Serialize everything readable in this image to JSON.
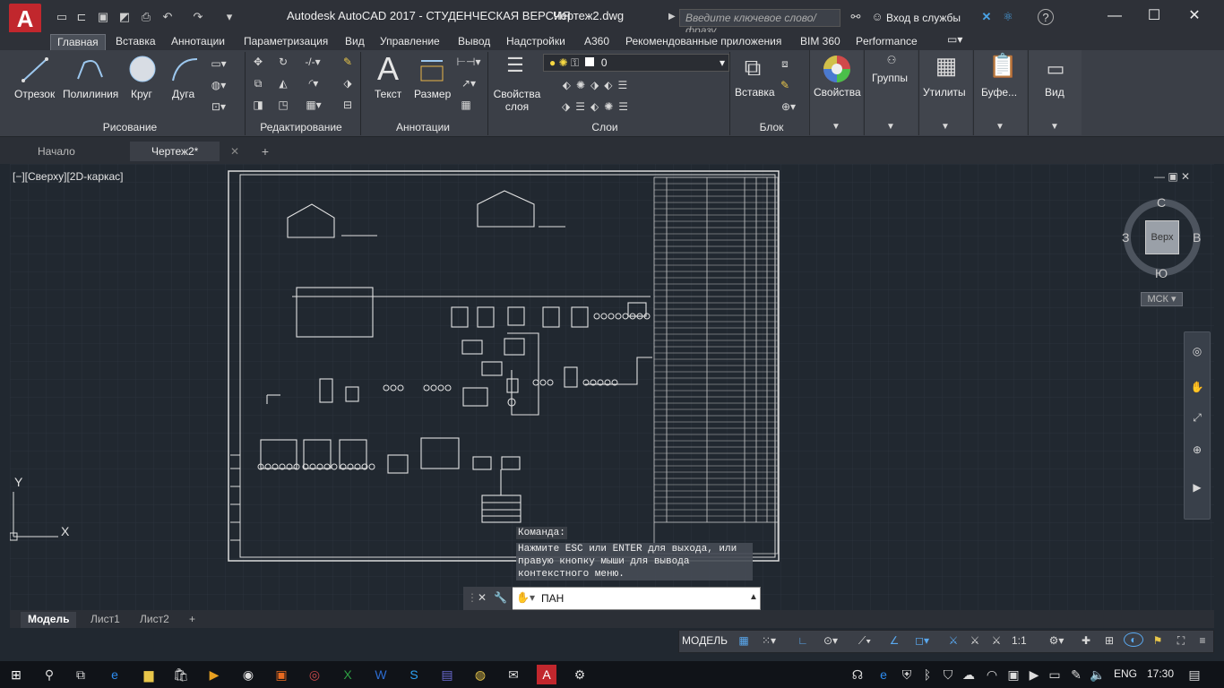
{
  "titlebar": {
    "app_letter": "A",
    "title": "Autodesk AutoCAD 2017 - СТУДЕНЧЕСКАЯ ВЕРСИЯ",
    "filename": "Чертеж2.dwg",
    "search_placeholder": "Введите ключевое слово/фразу",
    "login": "Вход в службы"
  },
  "ribbon_tabs": [
    "Главная",
    "Вставка",
    "Аннотации",
    "Параметризация",
    "Вид",
    "Управление",
    "Вывод",
    "Надстройки",
    "A360",
    "Рекомендованные приложения",
    "BIM 360",
    "Performance"
  ],
  "draw_panel": {
    "title": "Рисование",
    "line": "Отрезок",
    "polyline": "Полилиния",
    "circle": "Круг",
    "arc": "Дуга"
  },
  "modify_panel": {
    "title": "Редактирование"
  },
  "annotation_panel": {
    "title": "Аннотации",
    "text": "Текст",
    "dimension": "Размер"
  },
  "layers_panel": {
    "title": "Слои",
    "properties": "Свойства слоя",
    "current_layer": "0"
  },
  "block_panel": {
    "title": "Блок",
    "insert": "Вставка"
  },
  "right_panels": {
    "properties": "Свойства",
    "groups": "Группы",
    "utilities": "Утилиты",
    "clipboard": "Буфе...",
    "view": "Вид"
  },
  "file_tabs": {
    "start": "Начало",
    "drawing": "Чертеж2*"
  },
  "viewport": {
    "label": "[−][Сверху][2D-каркас]"
  },
  "viewcube": {
    "north": "С",
    "south": "Ю",
    "east": "В",
    "west": "З",
    "face": "Верх",
    "ucs": "МСК"
  },
  "ucs_icon": {
    "x": "X",
    "y": "Y"
  },
  "command": {
    "history_label": "Команда:",
    "history_lines": [
      "Нажмите ESC или ENTER для выхода, или",
      "правую кнопку мыши для вывода",
      "контекстного меню."
    ],
    "input": "ПАН"
  },
  "layout_tabs": [
    "Модель",
    "Лист1",
    "Лист2"
  ],
  "statusbar": {
    "model": "МОДЕЛЬ",
    "scale": "1:1"
  },
  "taskbar": {
    "lang": "ENG",
    "time": "17:30"
  },
  "colors": {
    "accent": "#c1272d",
    "canvas": "#212830",
    "ribbon": "#3b3f47"
  }
}
